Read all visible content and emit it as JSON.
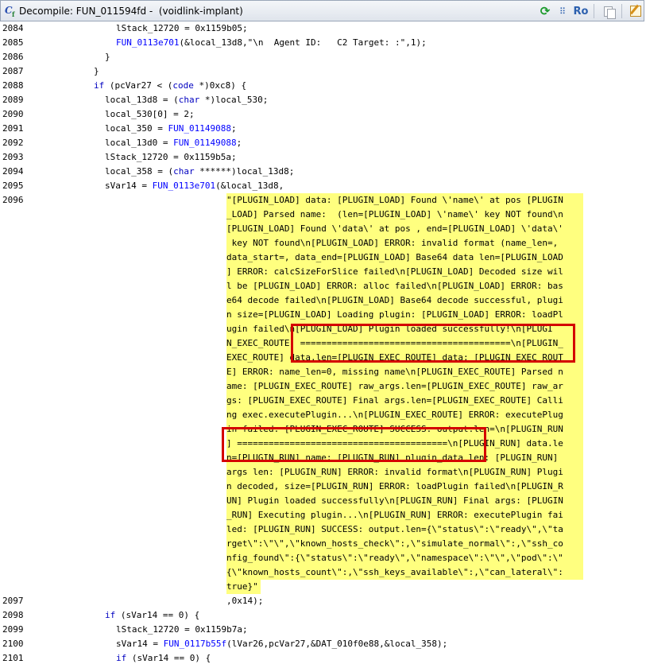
{
  "window": {
    "title": "Decompile: FUN_011594fd -  (voidlink-implant)",
    "ro_label": "Ro"
  },
  "lines": {
    "l2084": {
      "num": "2084",
      "text": "lStack_12720 = 0x1159b05;"
    },
    "l2085": {
      "num": "2085",
      "fn": "FUN_0113e701",
      "rest": "(&local_13d8,\"\\n  Agent ID:   C2 Target: :\",1);"
    },
    "l2086": {
      "num": "2086",
      "text": "}"
    },
    "l2087": {
      "num": "2087",
      "text": "}"
    },
    "l2088": {
      "num": "2088",
      "kw": "if",
      "a": " (pcVar27 < (",
      "ty": "code",
      "b": " *)0xc8) {"
    },
    "l2089": {
      "num": "2089",
      "a": "local_13d8 = (",
      "ty": "char",
      "b": " *)local_530;"
    },
    "l2090": {
      "num": "2090",
      "text": "local_530[0] = 2;"
    },
    "l2091": {
      "num": "2091",
      "a": "local_350 = ",
      "fn": "FUN_01149088",
      "b": ";"
    },
    "l2092": {
      "num": "2092",
      "a": "local_13d0 = ",
      "fn": "FUN_01149088",
      "b": ";"
    },
    "l2093": {
      "num": "2093",
      "text": "lStack_12720 = 0x1159b5a;"
    },
    "l2094": {
      "num": "2094",
      "a": "local_358 = (",
      "ty": "char",
      "b": " ******)local_13d8;"
    },
    "l2095": {
      "num": "2095",
      "a": "sVar14 = ",
      "fn": "FUN_0113e701",
      "b": "(&local_13d8,"
    },
    "l2096": {
      "num": "2096"
    },
    "l2097": {
      "num": "2097",
      "text": ",0x14);"
    },
    "l2098": {
      "num": "2098",
      "kw": "if",
      "a": " (sVar14 == 0) {"
    },
    "l2099": {
      "num": "2099",
      "text": "lStack_12720 = 0x1159b7a;"
    },
    "l2100": {
      "num": "2100",
      "a": "sVar14 = ",
      "fn": "FUN_0117b55f",
      "b": "(lVar26,pcVar27,&DAT_010f0e88,&local_358);"
    },
    "l2101": {
      "num": "2101",
      "kw": "if",
      "a": " (sVar14 == 0) {"
    }
  },
  "string_literal": [
    "\"[PLUGIN_LOAD] data: [PLUGIN_LOAD] Found \\'name\\' at pos [PLUGIN",
    "_LOAD] Parsed name:  (len=[PLUGIN_LOAD] \\'name\\' key NOT found\\n",
    "[PLUGIN_LOAD] Found \\'data\\' at pos , end=[PLUGIN_LOAD] \\'data\\'",
    " key NOT found\\n[PLUGIN_LOAD] ERROR: invalid format (name_len=,",
    "data_start=, data_end=[PLUGIN_LOAD] Base64 data len=[PLUGIN_LOAD",
    "] ERROR: calcSizeForSlice failed\\n[PLUGIN_LOAD] Decoded size wil",
    "l be [PLUGIN_LOAD] ERROR: alloc failed\\n[PLUGIN_LOAD] ERROR: bas",
    "e64 decode failed\\n[PLUGIN_LOAD] Base64 decode successful, plugi",
    "n size=[PLUGIN_LOAD] Loading plugin: [PLUGIN_LOAD] ERROR: loadPl",
    "ugin failed\\n[PLUGIN_LOAD] Plugin loaded successfully!\\n[PLUGI",
    "N_EXEC_ROUTE] ========================================\\n[PLUGIN_",
    "EXEC_ROUTE] data.len=[PLUGIN_EXEC_ROUTE] data: [PLUGIN_EXEC_ROUT",
    "E] ERROR: name_len=0, missing name\\n[PLUGIN_EXEC_ROUTE] Parsed n",
    "ame: [PLUGIN_EXEC_ROUTE] raw_args.len=[PLUGIN_EXEC_ROUTE] raw_ar",
    "gs: [PLUGIN_EXEC_ROUTE] Final args.len=[PLUGIN_EXEC_ROUTE] Calli",
    "ng exec.executePlugin...\\n[PLUGIN_EXEC_ROUTE] ERROR: executePlug",
    "in failed: [PLUGIN_EXEC_ROUTE] SUCCESS: output.len=\\n[PLUGIN_RUN",
    "] ========================================\\n[PLUGIN_RUN] data.le",
    "n=[PLUGIN_RUN] name: [PLUGIN_RUN] plugin_data len: [PLUGIN_RUN]",
    "args len: [PLUGIN_RUN] ERROR: invalid format\\n[PLUGIN_RUN] Plugi",
    "n decoded, size=[PLUGIN_RUN] ERROR: loadPlugin failed\\n[PLUGIN_R",
    "UN] Plugin loaded successfully\\n[PLUGIN_RUN] Final args: [PLUGIN",
    "_RUN] Executing plugin...\\n[PLUGIN_RUN] ERROR: executePlugin fai",
    "led: [PLUGIN_RUN] SUCCESS: output.len={\\\"status\\\":\\\"ready\\\",\\\"ta",
    "rget\\\":\\\"\\\",\\\"known_hosts_check\\\":,\\\"simulate_normal\\\":,\\\"ssh_co",
    "nfig_found\\\":{\\\"status\\\":\\\"ready\\\",\\\"namespace\\\":\\\"\\\",\\\"pod\\\":\\\"",
    "{\\\"known_hosts_count\\\":,\\\"ssh_keys_available\\\":,\\\"can_lateral\\\":",
    "true}\""
  ],
  "colors": {
    "highlight": "#ffff7f",
    "annotation_box": "#d40000",
    "function": "#0000ff",
    "keyword": "#0000c0"
  }
}
